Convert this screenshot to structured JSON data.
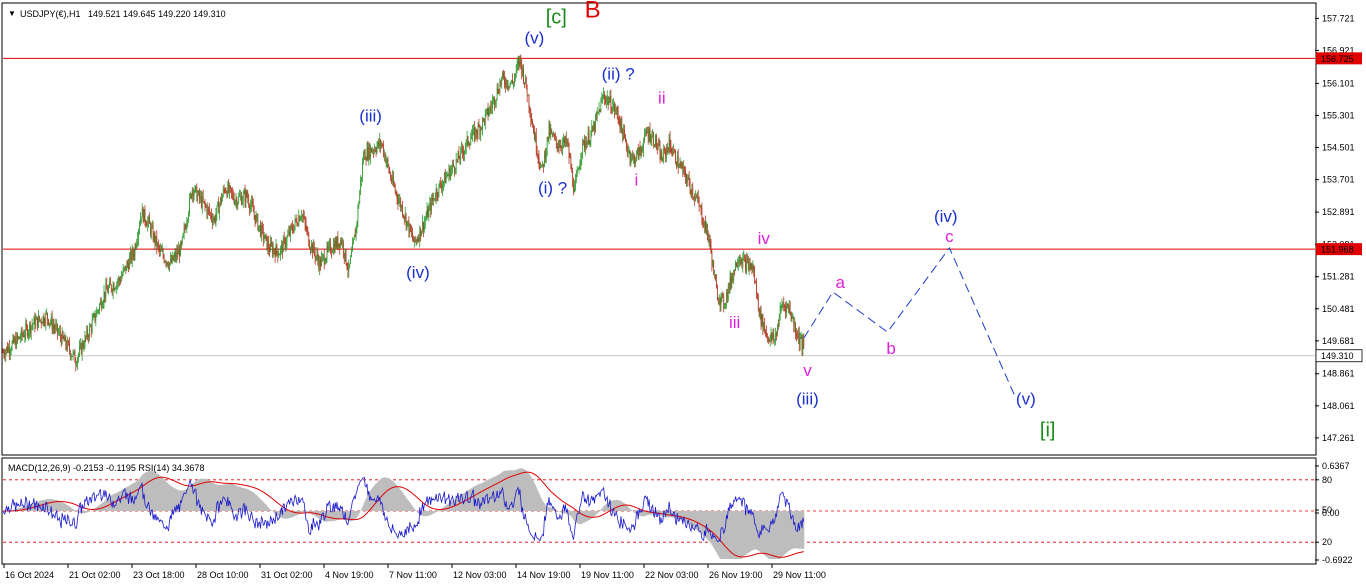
{
  "header": {
    "symbol": "USDJPY(€),H1",
    "ohlc": "149.521 149.645 149.220 149.310"
  },
  "indicator_header": "MACD(12,26,9) -0.2153 -0.1195 RSI(14) 34.3678",
  "colors": {
    "bull": "#2e9a2e",
    "bear": "#b0381f",
    "level": "#e00000",
    "macd_hist": "#bdbdbd",
    "macd_signal": "#e00000",
    "rsi": "#1a1acc",
    "projection": "#1a3cc8",
    "wave_blue": "#1a2fcf",
    "wave_magenta": "#e11fdc",
    "wave_green": "#1a8a1a",
    "wave_red": "#e00000"
  },
  "chart_data": {
    "type": "candlestick",
    "symbol": "USDJPY",
    "timeframe": "H1",
    "y_axis_ticks": [
      "157.721",
      "156.921",
      "156.101",
      "155.301",
      "154.501",
      "153.701",
      "152.891",
      "152.081",
      "151.281",
      "150.481",
      "149.681",
      "148.861",
      "148.061",
      "147.261"
    ],
    "ylim": [
      146.86,
      158.08
    ],
    "x_axis_ticks": [
      "16 Oct 2024",
      "21 Oct 02:00",
      "23 Oct 18:00",
      "28 Oct 10:00",
      "31 Oct 02:00",
      "4 Nov 19:00",
      "7 Nov 11:00",
      "12 Nov 03:00",
      "14 Nov 19:00",
      "19 Nov 11:00",
      "22 Nov 03:00",
      "26 Nov 19:00",
      "29 Nov 11:00"
    ],
    "horizontal_levels": [
      {
        "value": 156.725,
        "label": "156.725"
      },
      {
        "value": 151.968,
        "label": "151.968"
      }
    ],
    "current_price": {
      "value": 149.31,
      "label": "149.310"
    },
    "price_path": [
      {
        "x": 0,
        "y": 149.4
      },
      {
        "x": 4,
        "y": 149.7
      },
      {
        "x": 8,
        "y": 150.1
      },
      {
        "x": 12,
        "y": 150.3
      },
      {
        "x": 15,
        "y": 149.9
      },
      {
        "x": 18,
        "y": 149.5
      },
      {
        "x": 20,
        "y": 149.2
      },
      {
        "x": 24,
        "y": 150.0
      },
      {
        "x": 28,
        "y": 150.9
      },
      {
        "x": 32,
        "y": 151.2
      },
      {
        "x": 36,
        "y": 151.9
      },
      {
        "x": 38,
        "y": 152.9
      },
      {
        "x": 40,
        "y": 152.6
      },
      {
        "x": 43,
        "y": 151.9
      },
      {
        "x": 46,
        "y": 151.6
      },
      {
        "x": 49,
        "y": 152.0
      },
      {
        "x": 52,
        "y": 153.5
      },
      {
        "x": 55,
        "y": 153.1
      },
      {
        "x": 58,
        "y": 152.7
      },
      {
        "x": 61,
        "y": 153.5
      },
      {
        "x": 64,
        "y": 153.2
      },
      {
        "x": 67,
        "y": 153.3
      },
      {
        "x": 70,
        "y": 152.6
      },
      {
        "x": 73,
        "y": 152.0
      },
      {
        "x": 76,
        "y": 151.9
      },
      {
        "x": 79,
        "y": 152.4
      },
      {
        "x": 82,
        "y": 152.9
      },
      {
        "x": 84,
        "y": 152.2
      },
      {
        "x": 87,
        "y": 151.6
      },
      {
        "x": 90,
        "y": 152.0
      },
      {
        "x": 93,
        "y": 152.2
      },
      {
        "x": 95,
        "y": 151.4
      },
      {
        "x": 97,
        "y": 152.5
      },
      {
        "x": 99,
        "y": 154.3
      },
      {
        "x": 102,
        "y": 154.5
      },
      {
        "x": 104,
        "y": 154.6
      },
      {
        "x": 107,
        "y": 153.6
      },
      {
        "x": 110,
        "y": 152.9
      },
      {
        "x": 113,
        "y": 152.1
      },
      {
        "x": 116,
        "y": 152.7
      },
      {
        "x": 119,
        "y": 153.4
      },
      {
        "x": 122,
        "y": 153.8
      },
      {
        "x": 125,
        "y": 154.2
      },
      {
        "x": 128,
        "y": 154.7
      },
      {
        "x": 131,
        "y": 155.0
      },
      {
        "x": 134,
        "y": 155.5
      },
      {
        "x": 137,
        "y": 156.2
      },
      {
        "x": 140,
        "y": 156.1
      },
      {
        "x": 142,
        "y": 156.7
      },
      {
        "x": 144,
        "y": 155.9
      },
      {
        "x": 146,
        "y": 154.8
      },
      {
        "x": 148,
        "y": 153.9
      },
      {
        "x": 150,
        "y": 154.9
      },
      {
        "x": 152,
        "y": 154.6
      },
      {
        "x": 155,
        "y": 154.6
      },
      {
        "x": 157,
        "y": 153.4
      },
      {
        "x": 159,
        "y": 154.5
      },
      {
        "x": 162,
        "y": 154.9
      },
      {
        "x": 165,
        "y": 155.8
      },
      {
        "x": 167,
        "y": 155.6
      },
      {
        "x": 169,
        "y": 155.3
      },
      {
        "x": 171,
        "y": 154.6
      },
      {
        "x": 173,
        "y": 154.2
      },
      {
        "x": 175,
        "y": 154.4
      },
      {
        "x": 177,
        "y": 154.9
      },
      {
        "x": 179,
        "y": 154.7
      },
      {
        "x": 181,
        "y": 154.2
      },
      {
        "x": 183,
        "y": 154.6
      },
      {
        "x": 185,
        "y": 154.2
      },
      {
        "x": 188,
        "y": 153.7
      },
      {
        "x": 191,
        "y": 153.1
      },
      {
        "x": 194,
        "y": 152.2
      },
      {
        "x": 196,
        "y": 150.9
      },
      {
        "x": 198,
        "y": 150.6
      },
      {
        "x": 200,
        "y": 151.2
      },
      {
        "x": 202,
        "y": 151.8
      },
      {
        "x": 204,
        "y": 151.6
      },
      {
        "x": 206,
        "y": 151.5
      },
      {
        "x": 208,
        "y": 150.3
      },
      {
        "x": 210,
        "y": 149.8
      },
      {
        "x": 212,
        "y": 149.7
      },
      {
        "x": 214,
        "y": 150.6
      },
      {
        "x": 216,
        "y": 150.5
      },
      {
        "x": 218,
        "y": 149.9
      },
      {
        "x": 220,
        "y": 149.5
      }
    ],
    "projection_path": [
      {
        "x": 220,
        "y": 149.75
      },
      {
        "x": 228,
        "y": 150.9
      },
      {
        "x": 243,
        "y": 149.9
      },
      {
        "x": 260,
        "y": 152.0
      },
      {
        "x": 278,
        "y": 148.3
      }
    ],
    "wave_labels": [
      {
        "text": "[c]",
        "x": 152,
        "y": 157.6,
        "color": "green"
      },
      {
        "text": "B",
        "x": 162,
        "y": 157.75,
        "color": "red"
      },
      {
        "text": "(v)",
        "x": 146,
        "y": 157.1,
        "color": "blue"
      },
      {
        "text": "(iii)",
        "x": 101,
        "y": 155.15,
        "color": "blue"
      },
      {
        "text": "(iv)",
        "x": 114,
        "y": 151.25,
        "color": "blue"
      },
      {
        "text": "(i) ?",
        "x": 151,
        "y": 153.35,
        "color": "blue"
      },
      {
        "text": "(ii) ?",
        "x": 169,
        "y": 156.2,
        "color": "blue"
      },
      {
        "text": "ii",
        "x": 181,
        "y": 155.6,
        "color": "magenta"
      },
      {
        "text": "i",
        "x": 174,
        "y": 153.55,
        "color": "magenta"
      },
      {
        "text": "iv",
        "x": 209,
        "y": 152.1,
        "color": "magenta"
      },
      {
        "text": "iii",
        "x": 201,
        "y": 150.0,
        "color": "magenta"
      },
      {
        "text": "v",
        "x": 221,
        "y": 148.8,
        "color": "magenta"
      },
      {
        "text": "(iii)",
        "x": 221,
        "y": 148.1,
        "color": "blue"
      },
      {
        "text": "a",
        "x": 230,
        "y": 151.0,
        "color": "magenta"
      },
      {
        "text": "b",
        "x": 244,
        "y": 149.35,
        "color": "magenta"
      },
      {
        "text": "(iv)",
        "x": 259,
        "y": 152.65,
        "color": "blue"
      },
      {
        "text": "c",
        "x": 260,
        "y": 152.15,
        "color": "magenta"
      },
      {
        "text": "(v)",
        "x": 281,
        "y": 148.1,
        "color": "blue"
      },
      {
        "text": "[i]",
        "x": 287,
        "y": 147.3,
        "color": "green"
      }
    ],
    "indicator": {
      "name": "MACD / RSI",
      "y_axis_ticks": [
        "0.6367",
        "80",
        "50",
        "0.00",
        "20",
        "-0.6922"
      ],
      "rsi_levels": [
        80,
        50,
        20
      ],
      "rsi_range": [
        0,
        100
      ]
    }
  }
}
